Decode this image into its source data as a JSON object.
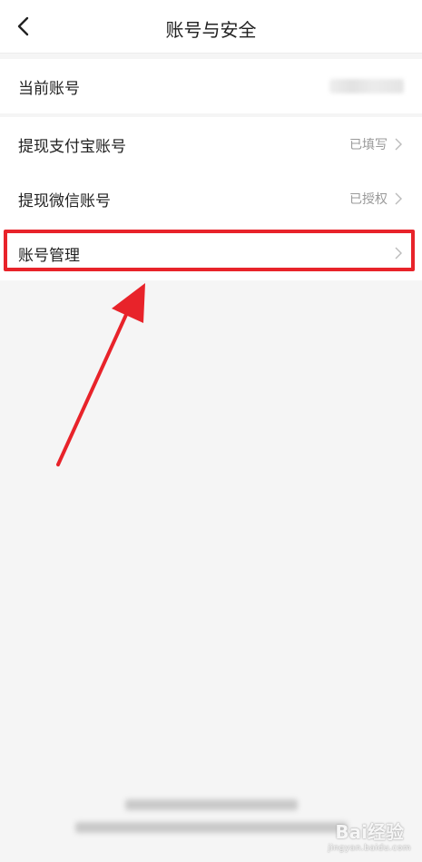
{
  "nav": {
    "title": "账号与安全"
  },
  "account_section": {
    "current_account_label": "当前账号",
    "current_account_value": ""
  },
  "withdraw_section": {
    "items": [
      {
        "label": "提现支付宝账号",
        "status": "已填写"
      },
      {
        "label": "提现微信账号",
        "status": "已授权"
      },
      {
        "label": "账号管理",
        "status": ""
      }
    ]
  },
  "annotation": {
    "highlight_color": "#e8232a",
    "arrow_color": "#e8232a"
  },
  "watermark": {
    "brand": "Bai经验",
    "url": "jingyan.baidu.com"
  },
  "icons": {
    "back": "chevron-left-icon",
    "row_chevron": "chevron-right-icon"
  }
}
